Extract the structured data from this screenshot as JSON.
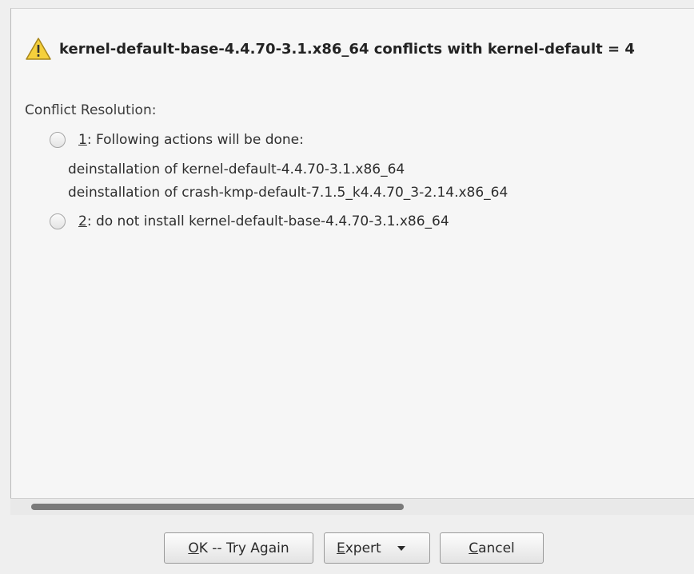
{
  "dialog": {
    "headline": "kernel-default-base-4.4.70-3.1.x86_64 conflicts with kernel-default = 4",
    "section_label": "Conflict Resolution:",
    "options": [
      {
        "accel": "1",
        "label_rest": ": Following actions will be done:",
        "details": [
          "deinstallation of kernel-default-4.4.70-3.1.x86_64",
          "deinstallation of crash-kmp-default-7.1.5_k4.4.70_3-2.14.x86_64"
        ],
        "selected": false
      },
      {
        "accel": "2",
        "label_rest": ": do not install kernel-default-base-4.4.70-3.1.x86_64",
        "selected": false
      }
    ]
  },
  "buttons": {
    "ok": {
      "accel": "O",
      "rest": "K -- Try Again"
    },
    "expert": {
      "accel": "E",
      "rest": "xpert"
    },
    "cancel": {
      "accel": "C",
      "rest": "ancel"
    }
  },
  "icons": {
    "warning": "warning-triangle-icon",
    "dropdown": "chevron-down-icon"
  },
  "colors": {
    "warning_fill": "#f5d03c",
    "warning_stroke": "#a8861a",
    "scroll_thumb": "#7a7a7a"
  }
}
